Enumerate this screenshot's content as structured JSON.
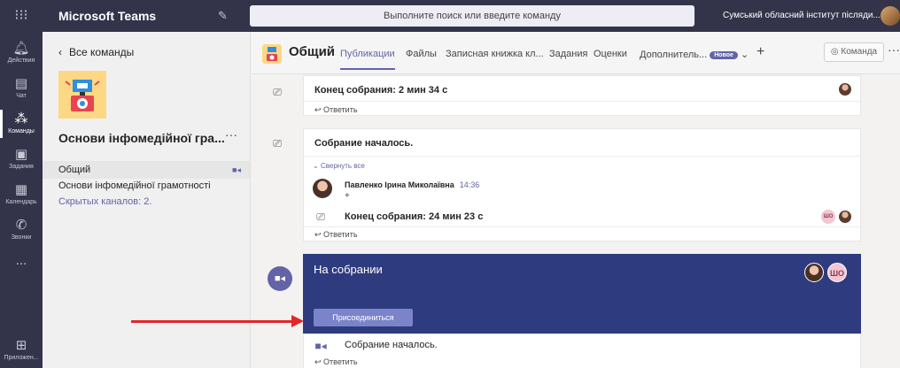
{
  "app": {
    "title": "Microsoft Teams",
    "search_placeholder": "Выполните поиск или введите команду",
    "org_name": "Сумський обласний інститут післяди... ⌄"
  },
  "rail": {
    "items": [
      {
        "label": "Действия",
        "icon": "bell-icon"
      },
      {
        "label": "Чат",
        "icon": "chat-icon"
      },
      {
        "label": "Команды",
        "icon": "teams-icon"
      },
      {
        "label": "Задания",
        "icon": "assignments-icon"
      },
      {
        "label": "Календарь",
        "icon": "calendar-icon"
      },
      {
        "label": "Звонки",
        "icon": "calls-icon"
      },
      {
        "label": "...",
        "icon": "more-icon"
      },
      {
        "label": "Приложен...",
        "icon": "apps-icon"
      }
    ]
  },
  "team_panel": {
    "back_label": "Все команды",
    "team_name": "Основи інфомедійної гра...",
    "more": "···",
    "channels": [
      {
        "label": "Общий"
      },
      {
        "label": "Основи інфомедійної грамотності"
      }
    ],
    "hidden_channels": "Скрытых каналов: 2."
  },
  "channel_header": {
    "name": "Общий",
    "tabs": [
      "Публикации",
      "Файлы",
      "Записная книжка кл...",
      "Задания",
      "Оценки",
      "Дополнитель..."
    ],
    "new_badge": "Новое",
    "more_tabs_chevron": "⌄",
    "add_tab": "+",
    "team_button": "◎ Команда",
    "more": "···"
  },
  "feed": {
    "post1": {
      "text": "Конец собрания: 2 мин 34 с",
      "reply": "Ответить"
    },
    "post2": {
      "text": "Собрание началось.",
      "collapse": "Свернуть все",
      "author": "Павленко Ірина Миколаївна",
      "time": "14:36",
      "plus": "+",
      "end_text": "Конец собрания: 24 мин 23 с",
      "initials": "ШО",
      "reply": "Ответить"
    },
    "meeting": {
      "title": "На собрании",
      "join_label": "Присоединиться",
      "initials": "ШО",
      "after_text": "Собрание началось.",
      "reply": "Ответить"
    }
  },
  "colors": {
    "rail_bg": "#33344a",
    "accent": "#6264a7",
    "meeting_bg": "#2e3b7f",
    "annotation_arrow": "#e3262a"
  }
}
